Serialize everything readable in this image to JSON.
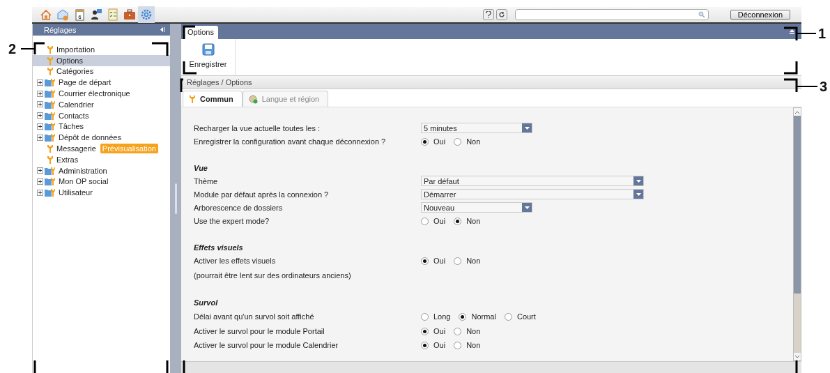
{
  "toolbar": {
    "modules": [
      {
        "selected": false
      },
      {
        "selected": false
      },
      {
        "selected": false
      },
      {
        "selected": false
      },
      {
        "selected": false
      },
      {
        "selected": false
      },
      {
        "selected": true
      }
    ],
    "calendar_day": "6",
    "logout": "Déconnexion"
  },
  "sidebar": {
    "title": "Réglages",
    "items": [
      {
        "label": "Importation",
        "kind": "leaf",
        "selected": false
      },
      {
        "label": "Options",
        "kind": "leaf",
        "selected": true
      },
      {
        "label": "Catégories",
        "kind": "leaf",
        "selected": false
      },
      {
        "label": "Page de départ",
        "kind": "folder",
        "expanded": false,
        "selected": false
      },
      {
        "label": "Courrier électronique",
        "kind": "folder",
        "expanded": false,
        "selected": false
      },
      {
        "label": "Calendrier",
        "kind": "folder",
        "expanded": false,
        "selected": false
      },
      {
        "label": "Contacts",
        "kind": "folder",
        "expanded": false,
        "selected": false
      },
      {
        "label": "Tâches",
        "kind": "folder",
        "expanded": false,
        "selected": false
      },
      {
        "label": "Dépôt de données",
        "kind": "folder",
        "expanded": false,
        "selected": false
      },
      {
        "label": "Messagerie",
        "kind": "leaf",
        "selected": false,
        "badge": "Prévisualisation"
      },
      {
        "label": "Extras",
        "kind": "leaf",
        "selected": false
      },
      {
        "label": "Administration",
        "kind": "folder",
        "expanded": false,
        "selected": false
      },
      {
        "label": "Mon OP social",
        "kind": "folder",
        "expanded": false,
        "selected": false
      },
      {
        "label": "Utilisateur",
        "kind": "folder",
        "expanded": false,
        "selected": false
      }
    ]
  },
  "ribbon": {
    "tab": "Options",
    "buttons": [
      {
        "label": "Enregistrer"
      }
    ]
  },
  "breadcrumb": "Réglages / Options",
  "tabs": [
    {
      "label": "Commun",
      "selected": true
    },
    {
      "label": "Langue et région",
      "selected": false
    }
  ],
  "rows": [
    {
      "kind": "select",
      "label": "Recharger la vue actuelle toutes les :",
      "value": "5 minutes"
    },
    {
      "kind": "radio",
      "label": "Enregistrer la configuration avant chaque déconnexion ?",
      "options": [
        {
          "label": "Oui",
          "selected": true
        },
        {
          "label": "Non",
          "selected": false
        }
      ]
    },
    {
      "kind": "heading",
      "label": "Vue"
    },
    {
      "kind": "select-wide",
      "label": "Thème",
      "value": "Par défaut"
    },
    {
      "kind": "select-wide",
      "label": "Module par défaut après la connexion ?",
      "value": "Démarrer"
    },
    {
      "kind": "select",
      "label": "Arborescence de dossiers",
      "value": "Nouveau"
    },
    {
      "kind": "radio",
      "label": "Use the expert mode?",
      "options": [
        {
          "label": "Oui",
          "selected": false
        },
        {
          "label": "Non",
          "selected": true
        }
      ]
    },
    {
      "kind": "heading",
      "label": "Effets visuels"
    },
    {
      "kind": "radio",
      "label": "Activer les effets visuels",
      "options": [
        {
          "label": "Oui",
          "selected": true
        },
        {
          "label": "Non",
          "selected": false
        }
      ]
    },
    {
      "kind": "note",
      "label": "(pourrait être lent sur des ordinateurs anciens)"
    },
    {
      "kind": "heading",
      "label": "Survol"
    },
    {
      "kind": "radio",
      "label": "Délai avant qu'un survol soit affiché",
      "options": [
        {
          "label": "Long",
          "selected": false
        },
        {
          "label": "Normal",
          "selected": true
        },
        {
          "label": "Court",
          "selected": false
        }
      ]
    },
    {
      "kind": "radio",
      "label": "Activer le survol pour le module Portail",
      "options": [
        {
          "label": "Oui",
          "selected": true
        },
        {
          "label": "Non",
          "selected": false
        }
      ]
    },
    {
      "kind": "radio",
      "label": "Activer le survol pour le module Calendrier",
      "options": [
        {
          "label": "Oui",
          "selected": true
        },
        {
          "label": "Non",
          "selected": false
        }
      ]
    }
  ],
  "callouts": [
    "1",
    "2",
    "3"
  ]
}
